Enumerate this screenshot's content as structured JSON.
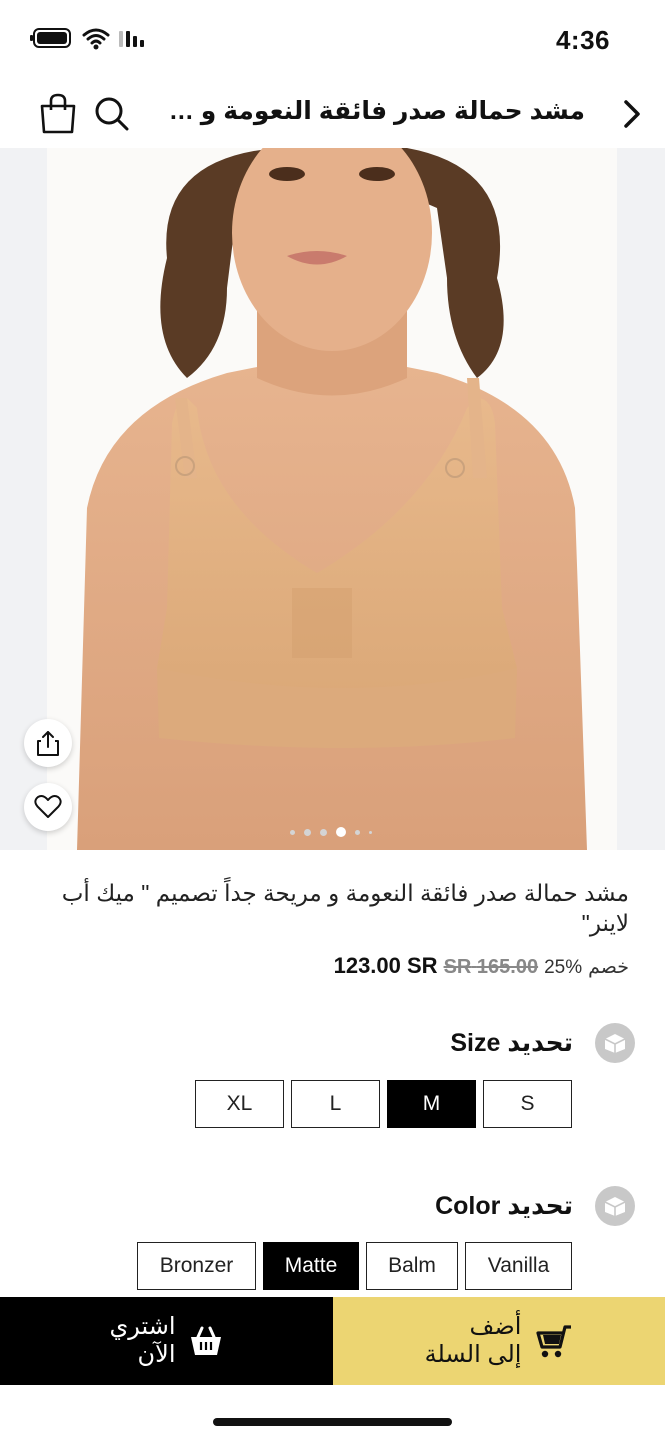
{
  "status_bar": {
    "time": "4:36"
  },
  "header": {
    "title": "مشد حمالة صدر فائقة النعومة و مر..."
  },
  "gallery": {
    "slide_count": 6,
    "active_slide": 4
  },
  "product": {
    "title": "مشد حمالة صدر فائقة النعومة و مريحة جداً تصميم \" ميك أب لاينر\"",
    "discount_label": "خصم",
    "discount_percent": "25%",
    "old_price": "165.00 SR",
    "new_price": "123.00 SR"
  },
  "size_section": {
    "title": "تحديد Size",
    "options": [
      "S",
      "M",
      "L",
      "XL"
    ],
    "selected": "M"
  },
  "color_section": {
    "title": "تحديد Color",
    "options": [
      "Vanilla",
      "Balm",
      "Matte",
      "Bronzer"
    ],
    "selected": "Matte"
  },
  "actions": {
    "add_to_cart_line1": "أضف",
    "add_to_cart_line2": "إلى السلة",
    "buy_now_line1": "اشتري",
    "buy_now_line2": "الآن"
  },
  "colors": {
    "accent_yellow": "#ecd572",
    "black": "#000000"
  },
  "icons": [
    "back-chevron-icon",
    "search-icon",
    "shopping-bag-icon",
    "share-icon",
    "heart-icon",
    "box-icon",
    "cart-icon",
    "basket-icon"
  ]
}
